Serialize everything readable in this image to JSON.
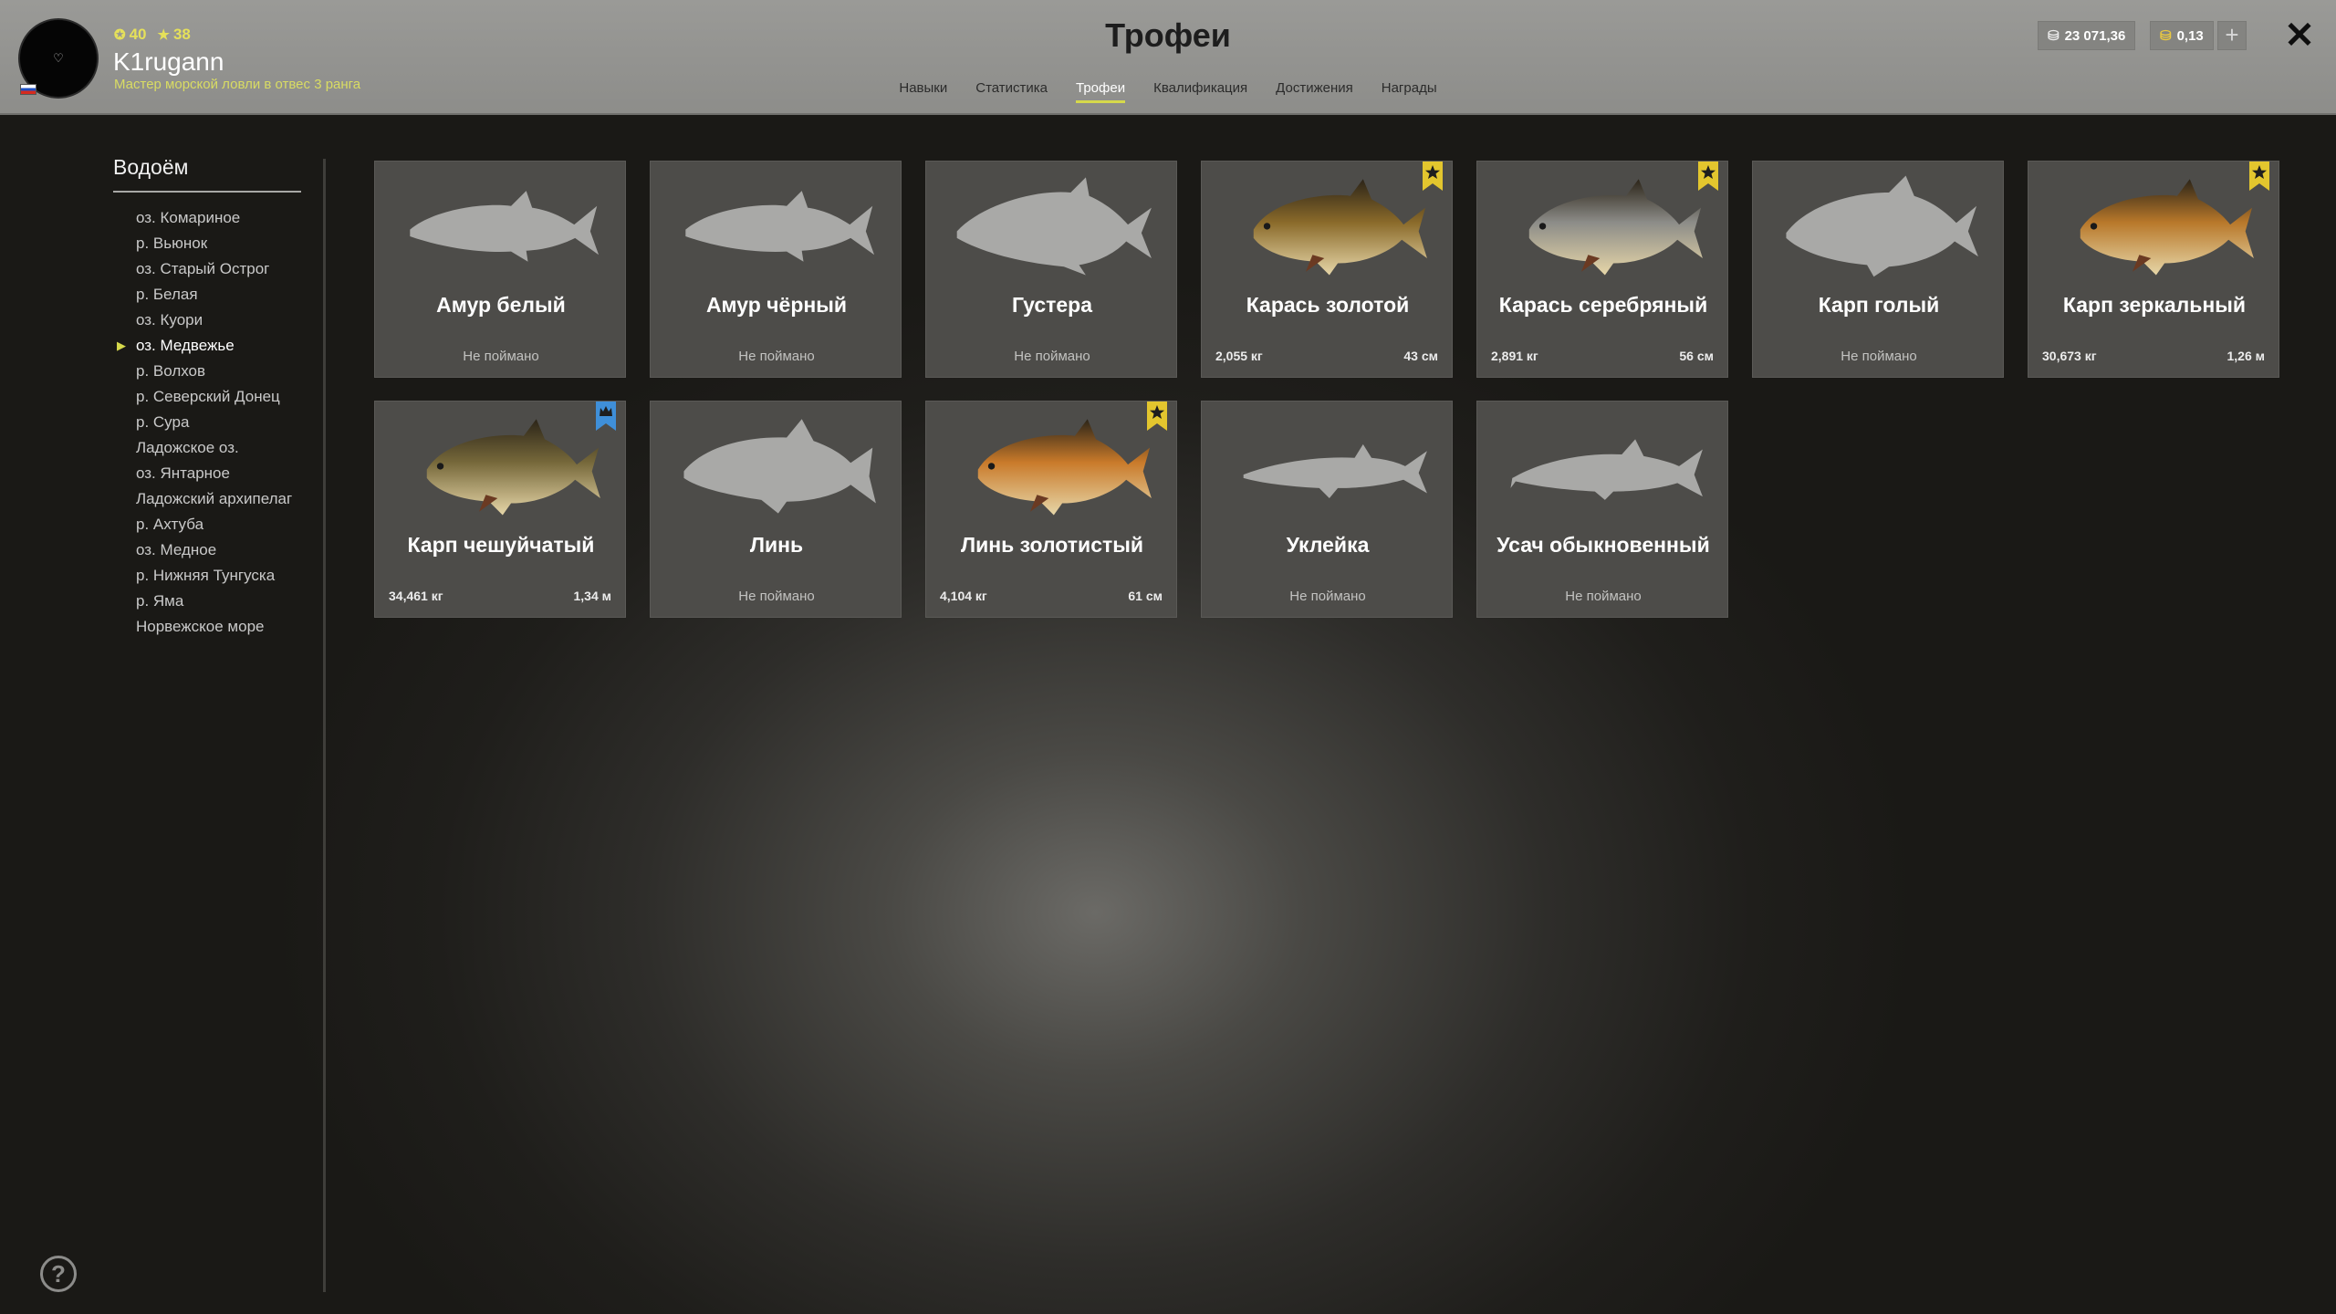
{
  "header": {
    "title": "Трофеи",
    "player": {
      "level": "40",
      "stars": "38",
      "name": "K1rugann",
      "rank": "Мастер морской ловли в отвес 3 ранга"
    },
    "tabs": [
      {
        "label": "Навыки",
        "active": false
      },
      {
        "label": "Статистика",
        "active": false
      },
      {
        "label": "Трофеи",
        "active": true
      },
      {
        "label": "Квалификация",
        "active": false
      },
      {
        "label": "Достижения",
        "active": false
      },
      {
        "label": "Награды",
        "active": false
      }
    ],
    "currency": {
      "silver": "23 071,36",
      "gold": "0,13",
      "add_label": "+"
    },
    "close_label": "✕"
  },
  "sidebar": {
    "title": "Водоём",
    "items": [
      {
        "label": "оз. Комариное",
        "active": false
      },
      {
        "label": "р. Вьюнок",
        "active": false
      },
      {
        "label": "оз. Старый Острог",
        "active": false
      },
      {
        "label": "р. Белая",
        "active": false
      },
      {
        "label": "оз. Куори",
        "active": false
      },
      {
        "label": "оз. Медвежье",
        "active": true
      },
      {
        "label": "р. Волхов",
        "active": false
      },
      {
        "label": "р. Северский Донец",
        "active": false
      },
      {
        "label": "р. Сура",
        "active": false
      },
      {
        "label": "Ладожское оз.",
        "active": false
      },
      {
        "label": "оз. Янтарное",
        "active": false
      },
      {
        "label": "Ладожский архипелаг",
        "active": false
      },
      {
        "label": "р. Ахтуба",
        "active": false
      },
      {
        "label": "оз. Медное",
        "active": false
      },
      {
        "label": "р. Нижняя Тунгуска",
        "active": false
      },
      {
        "label": "р. Яма",
        "active": false
      },
      {
        "label": "Норвежское море",
        "active": false
      }
    ]
  },
  "trophies": [
    {
      "name": "Амур белый",
      "status": "Не поймано",
      "caught": false,
      "shape": "amur"
    },
    {
      "name": "Амур чёрный",
      "status": "Не поймано",
      "caught": false,
      "shape": "amur"
    },
    {
      "name": "Густера",
      "status": "Не поймано",
      "caught": false,
      "shape": "bream"
    },
    {
      "name": "Карась золотой",
      "weight": "2,055 кг",
      "length": "43 см",
      "caught": true,
      "badge": "star",
      "color": "#8a6a2a"
    },
    {
      "name": "Карась серебряный",
      "weight": "2,891 кг",
      "length": "56 см",
      "caught": true,
      "badge": "star",
      "color": "#8c8c88"
    },
    {
      "name": "Карп голый",
      "status": "Не поймано",
      "caught": false,
      "shape": "carp"
    },
    {
      "name": "Карп зеркальный",
      "weight": "30,673 кг",
      "length": "1,26 м",
      "caught": true,
      "badge": "star",
      "color": "#b8782a"
    },
    {
      "name": "Карп чешуйчатый",
      "weight": "34,461 кг",
      "length": "1,34 м",
      "caught": true,
      "badge": "crown",
      "color": "#76683a"
    },
    {
      "name": "Линь",
      "status": "Не поймано",
      "caught": false,
      "shape": "tench"
    },
    {
      "name": "Линь золотистый",
      "weight": "4,104 кг",
      "length": "61 см",
      "caught": true,
      "badge": "star",
      "color": "#c97a2a"
    },
    {
      "name": "Уклейка",
      "status": "Не поймано",
      "caught": false,
      "shape": "slim"
    },
    {
      "name": "Усач обыкновенный",
      "status": "Не поймано",
      "caught": false,
      "shape": "barbel"
    }
  ],
  "colors": {
    "accent": "#d6d94b",
    "star_badge": "#e3c62e",
    "crown_badge": "#3f8fd8",
    "silhouette": "#a9a9a7"
  },
  "help_label": "?"
}
